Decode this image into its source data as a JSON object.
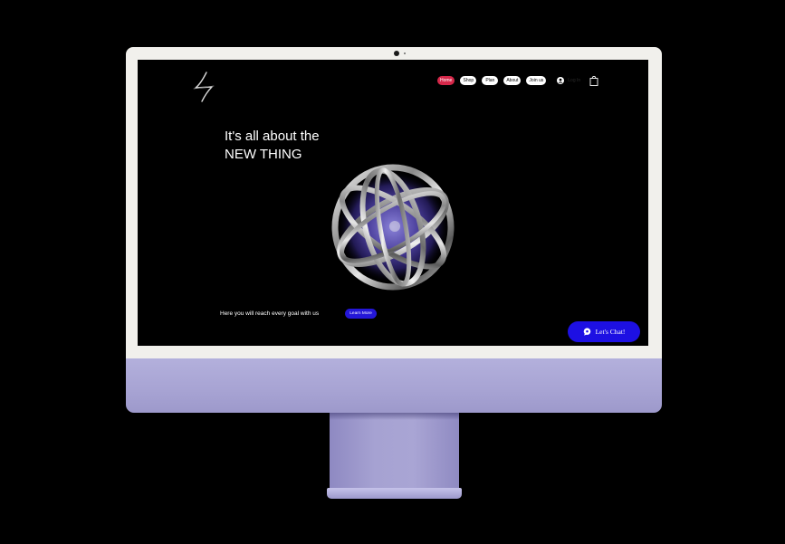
{
  "site": {
    "logo_icon": "lightning-bolt-logo-icon",
    "nav": {
      "items": [
        {
          "label": "Home",
          "active": true
        },
        {
          "label": "Shop",
          "active": false
        },
        {
          "label": "Plan",
          "active": false
        },
        {
          "label": "About",
          "active": false
        },
        {
          "label": "Join us",
          "active": false
        }
      ],
      "login_label": "Log In",
      "user_icon": "user-icon",
      "cart_icon": "shopping-bag-icon"
    },
    "hero": {
      "title_line1": "It's all about the",
      "title_line2": "NEW THING",
      "image": "chrome-ring-sphere"
    },
    "tagline": "Here you will reach every goal with us",
    "learn_more_label": "Learn More",
    "chat_label": "Let's Chat!",
    "chat_icon": "chat-bubble-icon"
  },
  "colors": {
    "active_nav": "#d6284a",
    "accent_blue": "#1d10e3",
    "monitor_purple": "#a9a5d4",
    "bezel": "#f1f0ec"
  }
}
